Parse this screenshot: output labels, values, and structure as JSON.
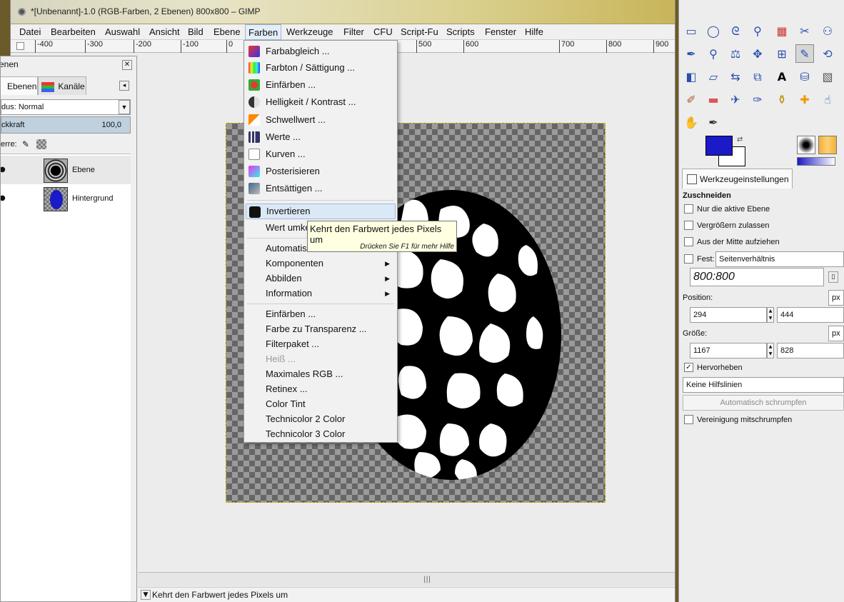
{
  "window": {
    "title": "*[Unbenannt]-1.0 (RGB-Farben, 2 Ebenen) 800x800 – GIMP"
  },
  "menubar": [
    {
      "label": "Datei"
    },
    {
      "label": "Bearbeiten"
    },
    {
      "label": "Auswahl"
    },
    {
      "label": "Ansicht"
    },
    {
      "label": "Bild"
    },
    {
      "label": "Ebene"
    },
    {
      "label": "Farben"
    },
    {
      "label": "Werkzeuge"
    },
    {
      "label": "Filter"
    },
    {
      "label": "CFU"
    },
    {
      "label": "Script-Fu"
    },
    {
      "label": "Scripts"
    },
    {
      "label": "Fenster"
    },
    {
      "label": "Hilfe"
    }
  ],
  "ruler": [
    "-400",
    "-300",
    "-200",
    "-100",
    "0",
    "500",
    "600",
    "700",
    "800",
    "900"
  ],
  "farben_menu": {
    "items": [
      {
        "label": "Farbabgleich ..."
      },
      {
        "label": "Farbton / Sättigung ..."
      },
      {
        "label": "Einfärben ..."
      },
      {
        "label": "Helligkeit / Kontrast ..."
      },
      {
        "label": "Schwellwert ..."
      },
      {
        "label": "Werte ..."
      },
      {
        "label": "Kurven ..."
      },
      {
        "label": "Posterisieren"
      },
      {
        "label": "Entsättigen ..."
      },
      {
        "label": "Invertieren"
      },
      {
        "label": "Wert umke"
      },
      {
        "label": "Automatis"
      },
      {
        "label": "Komponenten"
      },
      {
        "label": "Abbilden"
      },
      {
        "label": "Information"
      },
      {
        "label": "Einfärben ..."
      },
      {
        "label": "Farbe zu Transparenz ..."
      },
      {
        "label": "Filterpaket ..."
      },
      {
        "label": "Heiß ..."
      },
      {
        "label": "Maximales RGB ..."
      },
      {
        "label": "Retinex ..."
      },
      {
        "label": "Color Tint"
      },
      {
        "label": "Technicolor 2 Color"
      },
      {
        "label": "Technicolor 3 Color"
      }
    ]
  },
  "tooltip": {
    "text": "Kehrt den Farbwert jedes Pixels um",
    "hint": "Drücken Sie F1 für mehr Hilfe"
  },
  "layers_dock": {
    "title": "enen",
    "tabs": [
      {
        "label": "Ebenen"
      },
      {
        "label": "Kanäle"
      }
    ],
    "mode_label": "dus: Normal",
    "opacity_label": "ckkraft",
    "opacity_value": "100,0",
    "lock_label": "erre:",
    "layers": [
      {
        "name": "Ebene"
      },
      {
        "name": "Hintergrund"
      }
    ]
  },
  "statusbar": {
    "message": "Kehrt den Farbwert jedes Pixels um"
  },
  "tool_options": {
    "tab_label": "Werkzeugeinstellungen",
    "section": "Zuschneiden",
    "only_active_layer": "Nur die aktive Ebene",
    "allow_growing": "Vergrößern zulassen",
    "from_center": "Aus der Mitte aufziehen",
    "fixed_label": "Fest:",
    "fixed_select": "Seitenverhältnis",
    "ratio_value": "800:800",
    "position_label": "Position:",
    "position_unit": "px",
    "pos_x": "294",
    "pos_y": "444",
    "size_label": "Größe:",
    "size_unit": "px",
    "size_w": "1167",
    "size_h": "828",
    "highlight_label": "Hervorheben",
    "guides_select": "Keine Hilfslinien",
    "autoshrink_button": "Automatisch schrumpfen",
    "shrink_merged": "Vereinigung mitschrumpfen"
  },
  "colors": {
    "foreground": "#1a1ac8",
    "background": "#ffffff",
    "menu_hover": "#dbe8f6",
    "tooltip_bg": "#ffffe1"
  },
  "checkbox_states": {
    "only_active_layer": false,
    "allow_growing": false,
    "from_center": false,
    "fixed": false,
    "highlight": true,
    "shrink_merged": false
  }
}
